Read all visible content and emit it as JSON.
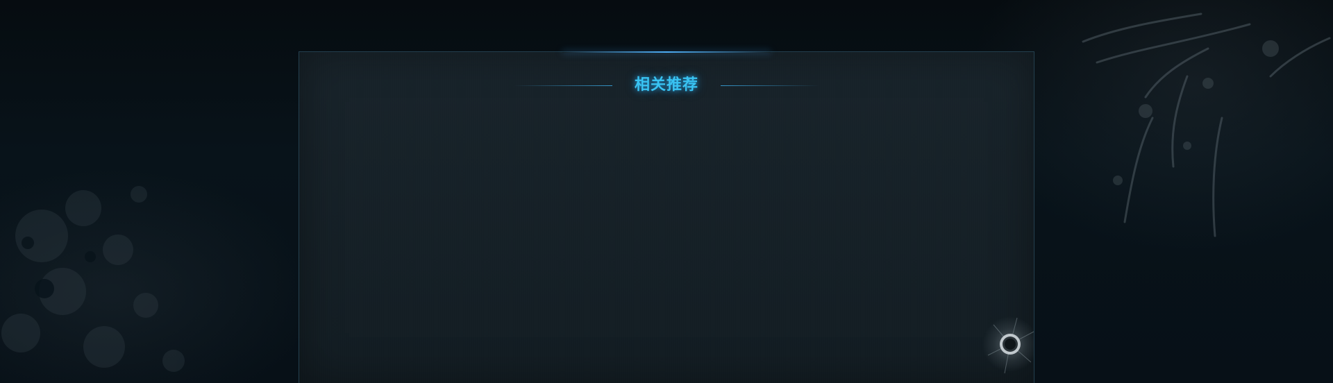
{
  "page": {
    "background_color": "#070e13",
    "panel_color": "#121c22",
    "accent_color": "#39c3f2"
  },
  "recommend": {
    "title": "相关推荐",
    "items": []
  },
  "decorations": {
    "left": "grunge-texture",
    "right": "scratch-texture",
    "corner": "bullet-hole-icon"
  }
}
